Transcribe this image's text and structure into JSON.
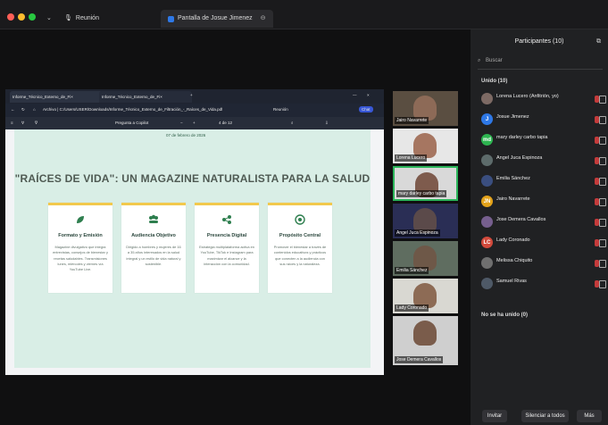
{
  "window": {
    "tab_meeting": "Reunión",
    "tab_screen": "Pantalla de Josue Jimenez"
  },
  "browser": {
    "tab1": "Informe_Técnico_Externo_de_Fi×",
    "tab2": "Informe_Técnico_Externo_de_Fi×",
    "address": "Archivo | C:/Users/USER/Downloads/Informe_Técnico_Externo_de_Filtración_-_Raíces_de_Vida.pdf",
    "toolbar_action": "Pregunta a Copilot",
    "page_counter": "4 de 12",
    "side_label": "Reunión",
    "chat_label": "Chat"
  },
  "doc": {
    "date": "07 de febrero de 2026",
    "title": "\"RAÍCES DE VIDA\": UN MAGAZINE NATURALISTA PARA LA SALUD",
    "cards": [
      {
        "icon": "leaf-icon",
        "heading": "Formato y Emisión",
        "text": "Magazine divulgativo que integra entrevistas, consejos de bienestar y recetas saludables. Transmisiones lunes, miércoles y viernes vía YouTube Live."
      },
      {
        "icon": "people-icon",
        "heading": "Audiencia Objetivo",
        "text": "Dirigido a hombres y mujeres de 16 a 35 años interesados en la salud integral y un estilo de vida natural y sostenible."
      },
      {
        "icon": "share-icon",
        "heading": "Presencia Digital",
        "text": "Estrategia multiplataforma activa en YouTube, TikTok e Instagram para maximizar el alcance y la interacción con la comunidad."
      },
      {
        "icon": "target-icon",
        "heading": "Propósito Central",
        "text": "Promover el bienestar a través de contenidos educativos y prácticos que conecten a la audiencia con sus raíces y la naturaleza."
      }
    ]
  },
  "video_thumbnails": [
    "Jairo Navarrete",
    "Lorena Lucero",
    "mary darley carbo tapia",
    "Angel Juca Espinoza",
    "Emilia Sánchez",
    "Lady Coronado",
    "Jose Demera Cavallos"
  ],
  "participants_panel": {
    "title": "Participantes (10)",
    "search_placeholder": "Buscar",
    "joined_header": "Unido (10)",
    "not_joined": "No se ha unido (0)",
    "participants": [
      {
        "initials": "",
        "name": "Lorena Lucero (Anfitrión, yo)",
        "avatar_color": "#7d6a64"
      },
      {
        "initials": "J",
        "name": "Josue Jimenez",
        "avatar_color": "#2e78e6"
      },
      {
        "initials": "md",
        "name": "mary darley carbo tapia",
        "avatar_color": "#2db450"
      },
      {
        "initials": "",
        "name": "Angel Juca Espinoza",
        "avatar_color": "#5d6b6b"
      },
      {
        "initials": "",
        "name": "Emilia Sánchez",
        "avatar_color": "#3a4e7f"
      },
      {
        "initials": "JN",
        "name": "Jairo Navarrete",
        "avatar_color": "#e3a21a"
      },
      {
        "initials": "",
        "name": "Jose Demera Cavallos",
        "avatar_color": "#765f8e"
      },
      {
        "initials": "LC",
        "name": "Lady Coronado",
        "avatar_color": "#d24a3c"
      },
      {
        "initials": "",
        "name": "Melissa Chiquito",
        "avatar_color": "#6f6f6f"
      },
      {
        "initials": "",
        "name": "Samuel Rivas",
        "avatar_color": "#4e5967"
      }
    ],
    "buttons": [
      "Invitar",
      "Silenciar a todos",
      "Más"
    ]
  }
}
